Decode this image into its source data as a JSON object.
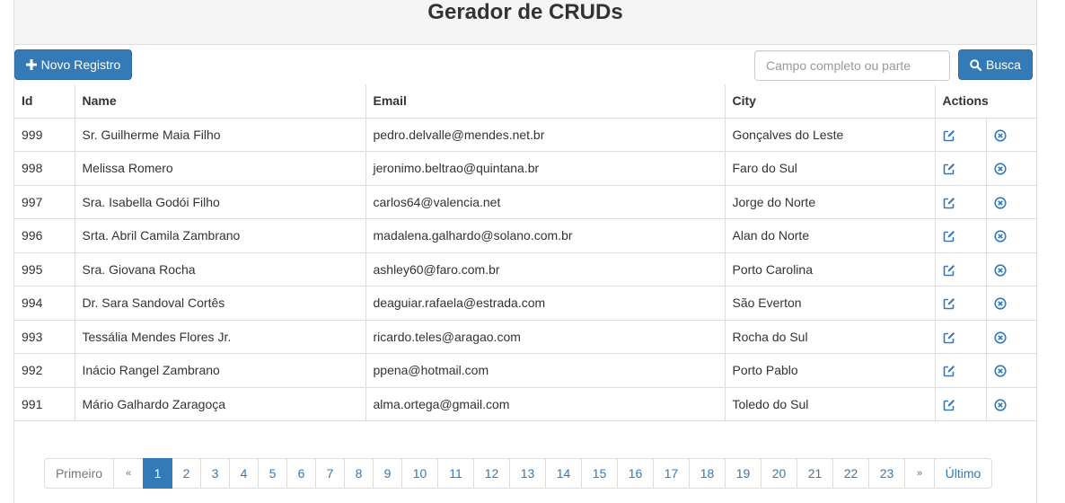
{
  "header": {
    "title": "Gerador de CRUDs"
  },
  "toolbar": {
    "new_label": "Novo Registro",
    "search_placeholder": "Campo completo ou parte",
    "search_value": "",
    "search_label": "Busca"
  },
  "table": {
    "columns": [
      "Id",
      "Name",
      "Email",
      "City",
      "Actions"
    ],
    "rows": [
      {
        "id": "999",
        "name": "Sr. Guilherme Maia Filho",
        "email": "pedro.delvalle@mendes.net.br",
        "city": "Gonçalves do Leste"
      },
      {
        "id": "998",
        "name": "Melissa Romero",
        "email": "jeronimo.beltrao@quintana.br",
        "city": "Faro do Sul"
      },
      {
        "id": "997",
        "name": "Sra. Isabella Godói Filho",
        "email": "carlos64@valencia.net",
        "city": "Jorge do Norte"
      },
      {
        "id": "996",
        "name": "Srta. Abril Camila Zambrano",
        "email": "madalena.galhardo@solano.com.br",
        "city": "Alan do Norte"
      },
      {
        "id": "995",
        "name": "Sra. Giovana Rocha",
        "email": "ashley60@faro.com.br",
        "city": "Porto Carolina"
      },
      {
        "id": "994",
        "name": "Dr. Sara Sandoval Cortês",
        "email": "deaguiar.rafaela@estrada.com",
        "city": "São Everton"
      },
      {
        "id": "993",
        "name": "Tessália Mendes Flores Jr.",
        "email": "ricardo.teles@aragao.com",
        "city": "Rocha do Sul"
      },
      {
        "id": "992",
        "name": "Inácio Rangel Zambrano",
        "email": "ppena@hotmail.com",
        "city": "Porto Pablo"
      },
      {
        "id": "991",
        "name": "Mário Galhardo Zaragoça",
        "email": "alma.ortega@gmail.com",
        "city": "Toledo do Sul"
      }
    ]
  },
  "icons": {
    "new": "plus-icon",
    "search": "search-icon",
    "edit": "edit-icon",
    "delete": "delete-circle-icon"
  },
  "colors": {
    "primary": "#337ab7",
    "border": "#dddddd",
    "header_bg": "#f5f5f5"
  },
  "pagination": {
    "first": "Primeiro",
    "prev": "«",
    "pages": [
      "1",
      "2",
      "3",
      "4",
      "5",
      "6",
      "7",
      "8",
      "9",
      "10",
      "11",
      "12",
      "13",
      "14",
      "15",
      "16",
      "17",
      "18",
      "19",
      "20",
      "21",
      "22",
      "23"
    ],
    "current": "1",
    "next": "»",
    "last": "Último"
  }
}
